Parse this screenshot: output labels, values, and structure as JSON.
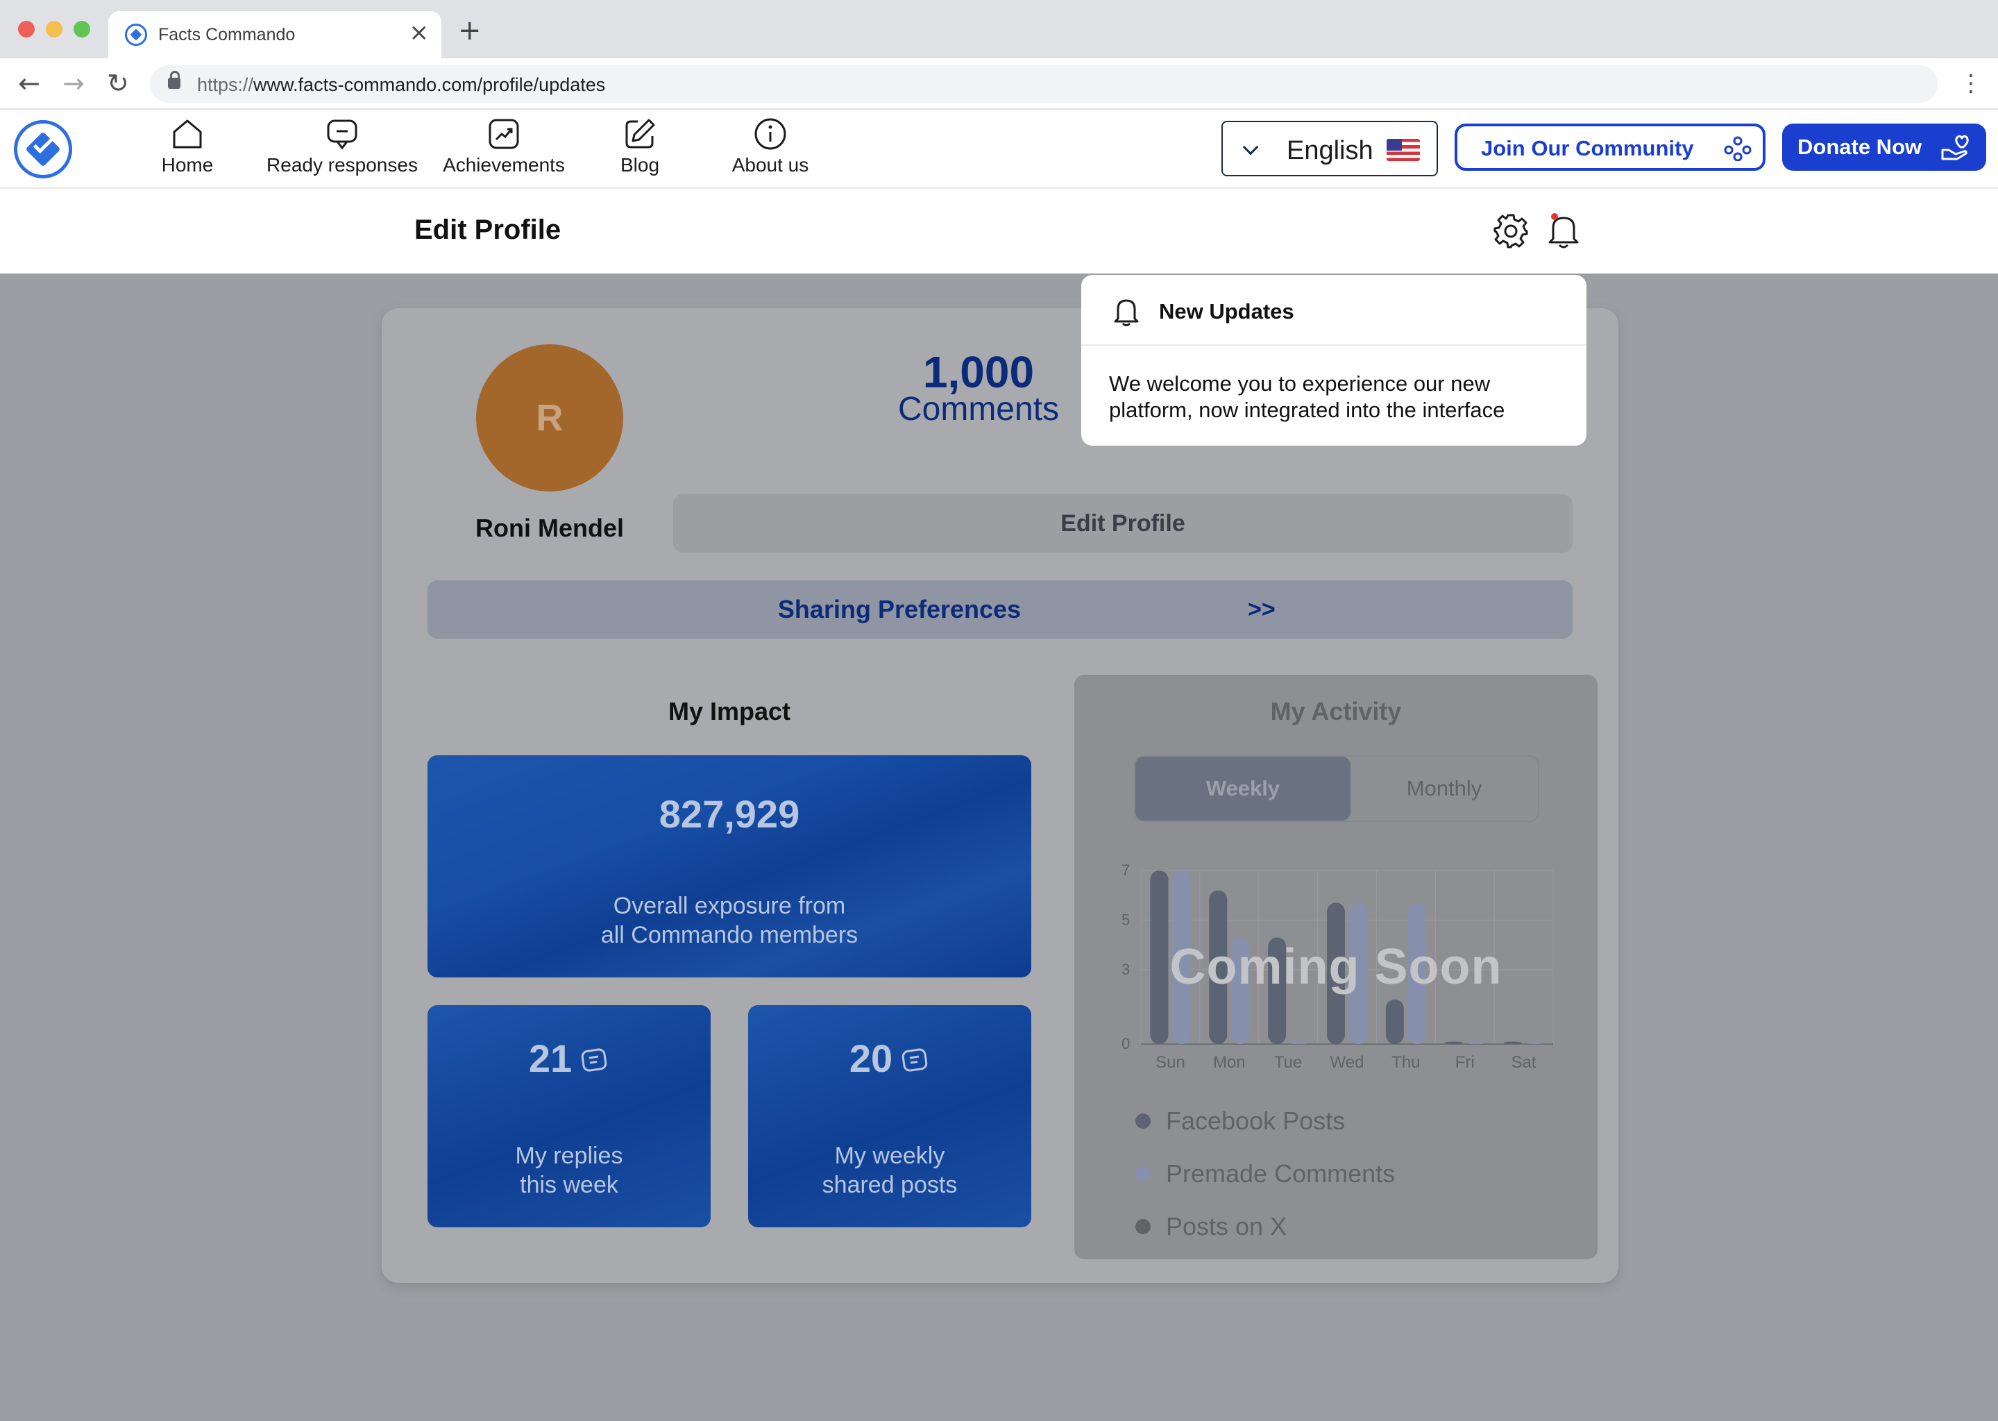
{
  "browser": {
    "tab_title": "Facts Commando",
    "close_glyph": "×",
    "new_tab_glyph": "+",
    "url_scheme": "https://",
    "url_rest": "www.facts-commando.com/profile/updates",
    "back_glyph": "←",
    "forward_glyph": "→",
    "reload_glyph": "↻",
    "menu_glyph": "⋮"
  },
  "nav": {
    "items": [
      {
        "label": "Home",
        "icon": "home-icon"
      },
      {
        "label": "Ready responses",
        "icon": "chat-minus-icon"
      },
      {
        "label": "Achievements",
        "icon": "trend-chart-icon"
      },
      {
        "label": "Blog",
        "icon": "edit-icon"
      },
      {
        "label": "About us",
        "icon": "info-icon"
      }
    ],
    "language": "English",
    "join_label": "Join Our Community",
    "donate_label": "Donate Now"
  },
  "subheader": {
    "title": "Edit Profile"
  },
  "profile": {
    "avatar_letter": "R",
    "name": "Roni Mendel",
    "comments_count": "1,000",
    "comments_label": "Comments",
    "edit_button": "Edit Profile",
    "sharing_label": "Sharing Preferences",
    "sharing_arrow": ">>"
  },
  "impact": {
    "title": "My Impact",
    "overall_value": "827,929",
    "overall_line1": "Overall exposure from",
    "overall_line2": "all Commando members",
    "replies_value": "21",
    "replies_line1": "My replies",
    "replies_line2": "this week",
    "shared_value": "20",
    "shared_line1": "My weekly",
    "shared_line2": "shared posts"
  },
  "activity": {
    "title": "My Activity",
    "tab_weekly": "Weekly",
    "tab_monthly": "Monthly",
    "overlay_text": "Coming Soon",
    "legend": [
      {
        "label": "Facebook Posts",
        "color": "#5c6372"
      },
      {
        "label": "Premade Comments",
        "color": "#8690ad"
      },
      {
        "label": "Posts on X",
        "color": "#5f6266"
      }
    ]
  },
  "chart_data": {
    "type": "bar",
    "categories": [
      "Sun",
      "Mon",
      "Tue",
      "Wed",
      "Thu",
      "Fri",
      "Sat"
    ],
    "yticks": [
      "0",
      "3",
      "5",
      "7"
    ],
    "ylim": [
      0,
      7
    ],
    "series": [
      {
        "name": "Facebook Posts",
        "color": "#5c6372",
        "values": [
          7,
          6.2,
          4.3,
          5.7,
          1.8,
          0.1,
          0.1
        ]
      },
      {
        "name": "Premade Comments",
        "color": "#8690ad",
        "values": [
          7,
          4.3,
          0.1,
          5.7,
          5.7,
          0.1,
          0.1
        ]
      }
    ]
  },
  "notification": {
    "title": "New Updates",
    "message": "We welcome you to experience our new platform, now integrated into the interface"
  }
}
